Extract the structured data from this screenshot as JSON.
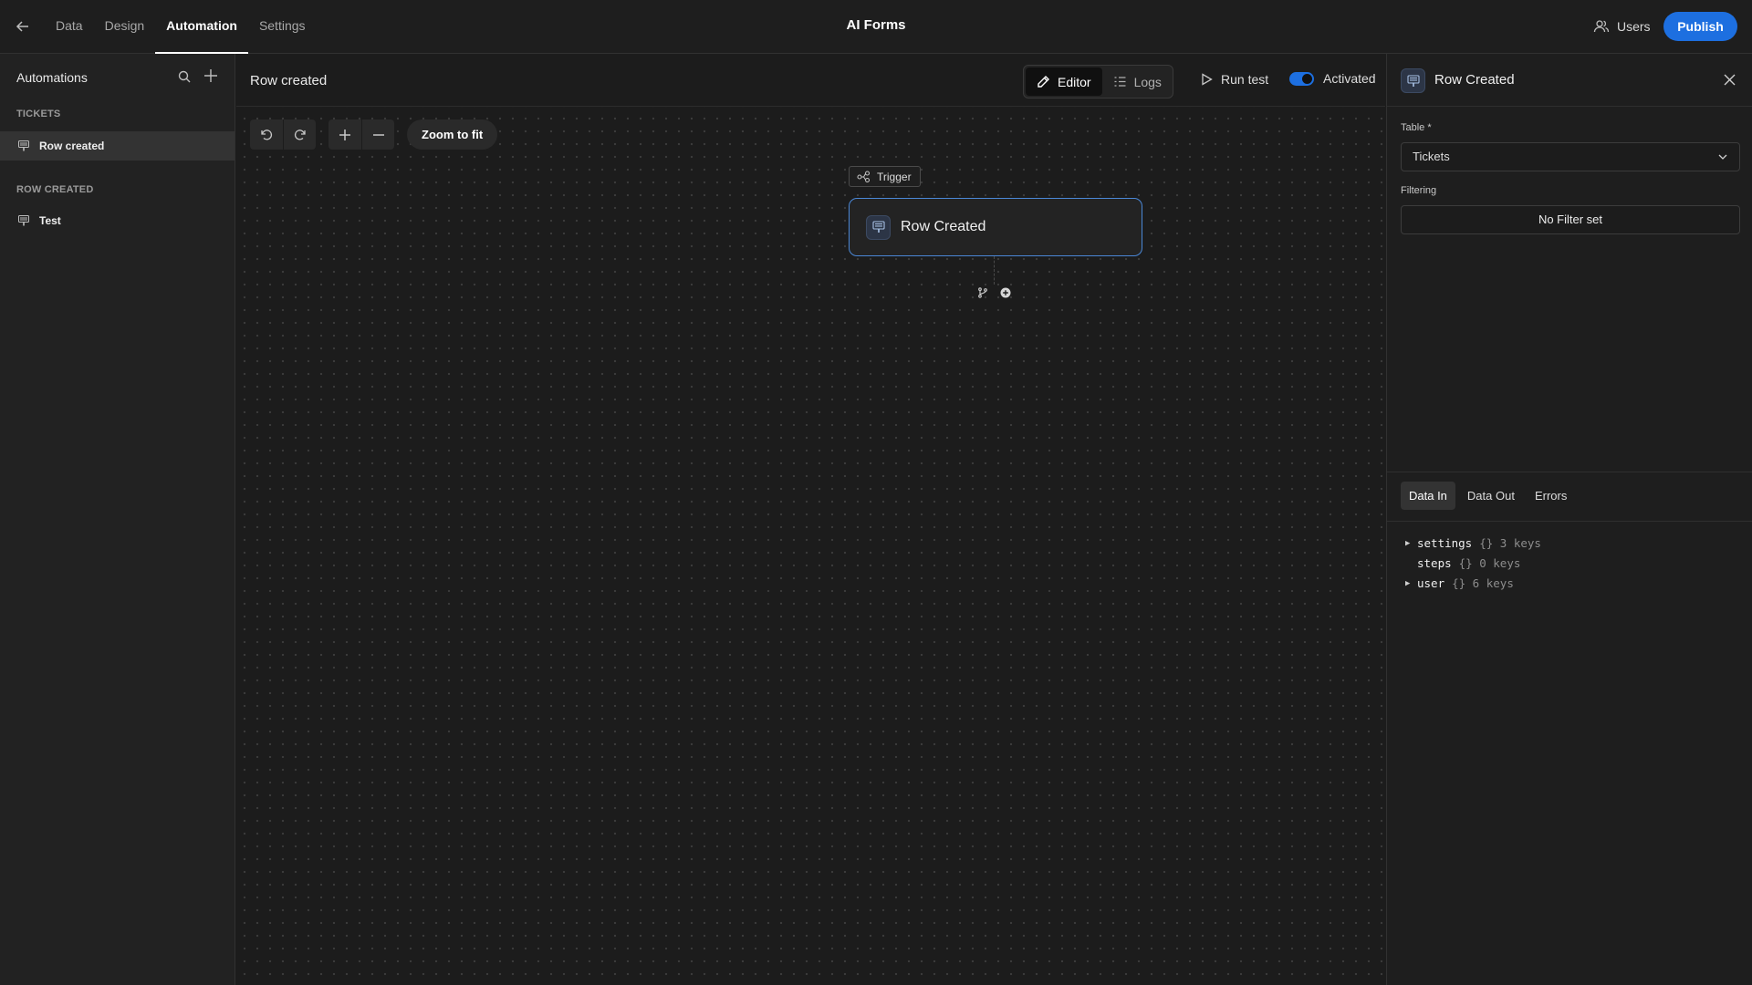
{
  "topbar": {
    "tabs": [
      {
        "label": "Data",
        "active": false
      },
      {
        "label": "Design",
        "active": false
      },
      {
        "label": "Automation",
        "active": true
      },
      {
        "label": "Settings",
        "active": false
      }
    ],
    "app_title": "AI Forms",
    "users_label": "Users",
    "publish_label": "Publish"
  },
  "sidebar": {
    "title": "Automations",
    "groups": [
      {
        "label": "TICKETS",
        "items": [
          {
            "label": "Row created",
            "selected": true
          }
        ]
      },
      {
        "label": "ROW CREATED",
        "items": [
          {
            "label": "Test",
            "selected": false
          }
        ]
      }
    ]
  },
  "canvas": {
    "title": "Row created",
    "view_tabs": [
      {
        "label": "Editor",
        "active": true,
        "icon": "pencil-icon"
      },
      {
        "label": "Logs",
        "active": false,
        "icon": "list-icon"
      }
    ],
    "run_test_label": "Run test",
    "activated_label": "Activated",
    "activated": true,
    "zoom_fit_label": "Zoom to fit",
    "trigger_tag": "Trigger",
    "node": {
      "label": "Row Created",
      "icon": "row-icon"
    }
  },
  "panel": {
    "title": "Row Created",
    "table_label": "Table *",
    "table_value": "Tickets",
    "filtering_label": "Filtering",
    "filter_button": "No Filter set",
    "data_tabs": [
      {
        "label": "Data In",
        "active": true
      },
      {
        "label": "Data Out",
        "active": false
      },
      {
        "label": "Errors",
        "active": false
      }
    ],
    "json_entries": [
      {
        "key": "settings",
        "meta": "{} 3 keys",
        "expandable": true
      },
      {
        "key": "steps",
        "meta": "{} 0 keys",
        "expandable": false
      },
      {
        "key": "user",
        "meta": "{} 6 keys",
        "expandable": true
      }
    ]
  },
  "colors": {
    "accent": "#1d6fe0",
    "node_border": "#4a87d6",
    "background": "#1c1c1c"
  }
}
